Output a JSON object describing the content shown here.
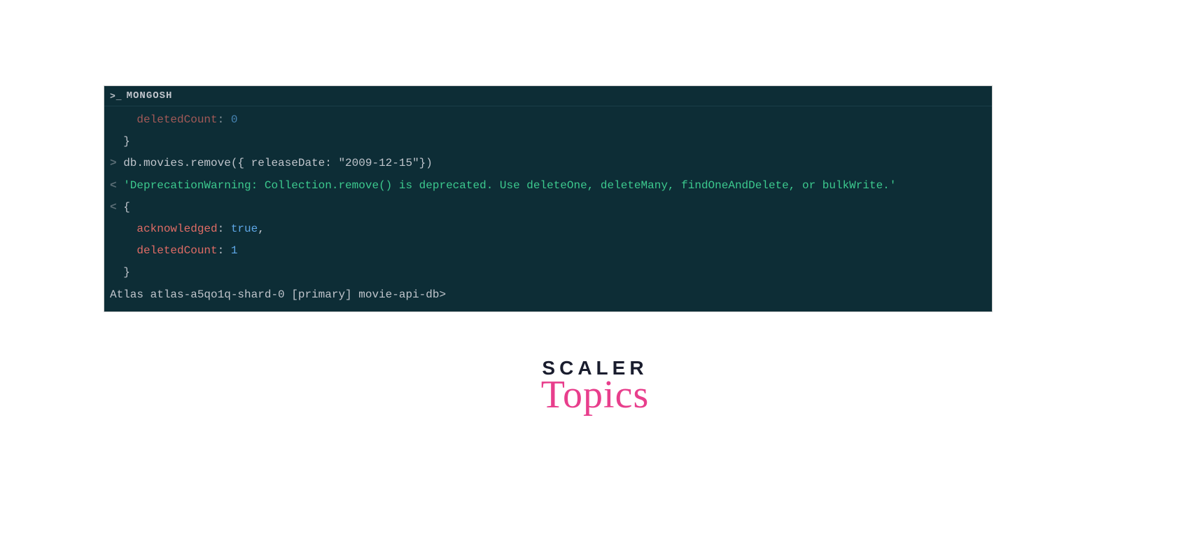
{
  "terminal": {
    "header_prompt": ">_",
    "header_title": "MONGOSH",
    "lines": {
      "prev_deleted_key": "deletedCount",
      "prev_deleted_sep": ": ",
      "prev_deleted_val": "0",
      "close1": "  }",
      "cmd_marker": "> ",
      "cmd_text": "db.movies.remove({ releaseDate: \"2009-12-15\"})",
      "warn_marker": "< ",
      "warn_text": "'DeprecationWarning: Collection.remove() is deprecated. Use deleteOne, deleteMany, findOneAndDelete, or bulkWrite.'",
      "open_marker": "< ",
      "open_brace": "{",
      "ack_key": "acknowledged",
      "ack_sep": ": ",
      "ack_val": "true",
      "ack_comma": ",",
      "delcount_key": "deletedCount",
      "delcount_sep": ": ",
      "delcount_val": "1",
      "close2": "  }",
      "atlas_prompt": "Atlas atlas-a5qo1q-shard-0 [primary] movie-api-db>"
    }
  },
  "logo": {
    "line1": "SCALER",
    "line2": "Topics"
  },
  "colors": {
    "terminal_bg": "#0d2d36",
    "text": "#c0c5cc",
    "key": "#e06c65",
    "literal": "#5fa8e8",
    "warn": "#3cc98e",
    "logo_dark": "#1a1d2e",
    "logo_pink": "#e83e8c"
  }
}
